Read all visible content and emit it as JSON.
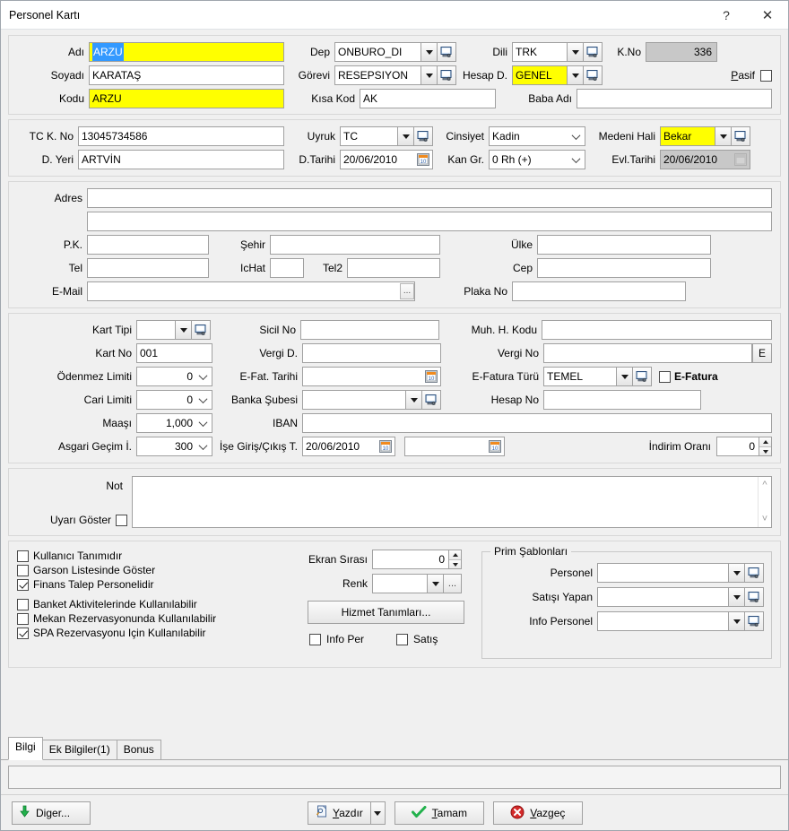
{
  "window": {
    "title": "Personel Kartı",
    "help_label": "?",
    "close_label": "✕"
  },
  "identity": {
    "adi_label": "Adı",
    "adi_value": "ARZU",
    "soyadi_label": "Soyadı",
    "soyadi_value": "KARATAŞ",
    "kodu_label": "Kodu",
    "kodu_value": "ARZU",
    "dep_label": "Dep",
    "dep_value": "ONBURO_DI",
    "gorevi_label": "Görevi",
    "gorevi_value": "RESEPSIYON",
    "kisa_kod_label": "Kısa Kod",
    "kisa_kod_value": "AK",
    "dili_label": "Dili",
    "dili_value": "TRK",
    "hesap_d_label": "Hesap D.",
    "hesap_d_value": "GENEL",
    "baba_adi_label": "Baba Adı",
    "baba_adi_value": "",
    "kno_label": "K.No",
    "kno_value": "336",
    "pasif_label": "Pasif",
    "pasif_checked": false
  },
  "personal": {
    "tc_label": "TC K. No",
    "tc_value": "13045734586",
    "dyeri_label": "D. Yeri",
    "dyeri_value": "ARTVİN",
    "uyruk_label": "Uyruk",
    "uyruk_value": "TC",
    "dtarihi_label": "D.Tarihi",
    "dtarihi_value": "20/06/2010",
    "cinsiyet_label": "Cinsiyet",
    "cinsiyet_value": "Kadin",
    "kangr_label": "Kan Gr.",
    "kangr_value": "0 Rh (+)",
    "medeni_label": "Medeni Hali",
    "medeni_value": "Bekar",
    "evltarihi_label": "Evl.Tarihi",
    "evltarihi_value": "20/06/2010"
  },
  "address": {
    "adres_label": "Adres",
    "adres_line1": "",
    "adres_line2": "",
    "pk_label": "P.K.",
    "pk_value": "",
    "sehir_label": "Şehir",
    "sehir_value": "",
    "ulke_label": "Ülke",
    "ulke_value": "",
    "tel_label": "Tel",
    "tel_value": "",
    "ichat_label": "IcHat",
    "ichat_value": "",
    "tel2_label": "Tel2",
    "tel2_value": "",
    "cep_label": "Cep",
    "cep_value": "",
    "email_label": "E-Mail",
    "email_value": "",
    "email_browse_label": "...",
    "plaka_label": "Plaka No",
    "plaka_value": ""
  },
  "financial": {
    "kart_tipi_label": "Kart Tipi",
    "kart_tipi_value": "",
    "kart_no_label": "Kart No",
    "kart_no_value": "001",
    "odenmez_label": "Ödenmez Limiti",
    "odenmez_value": "0",
    "cari_label": "Cari Limiti",
    "cari_value": "0",
    "maasi_label": "Maaşı",
    "maasi_value": "1,000",
    "asgari_label": "Asgari Geçim İ.",
    "asgari_value": "300",
    "sicil_label": "Sicil No",
    "sicil_value": "",
    "vergi_d_label": "Vergi D.",
    "vergi_d_value": "",
    "efat_tarihi_label": "E-Fat. Tarihi",
    "efat_tarihi_value": "",
    "banka_subesi_label": "Banka Şubesi",
    "banka_subesi_value": "",
    "iban_label": "IBAN",
    "iban_value": "",
    "ise_giris_label": "İşe Giriş/Çıkış T.",
    "ise_giris_value": "20/06/2010",
    "ise_cikis_value": "",
    "muh_h_kodu_label": "Muh. H. Kodu",
    "muh_h_kodu_value": "",
    "vergi_no_label": "Vergi No",
    "vergi_no_value": "",
    "vergi_no_button": "E",
    "efatura_turu_label": "E-Fatura Türü",
    "efatura_turu_value": "TEMEL",
    "efatura_label": "E-Fatura",
    "efatura_checked": false,
    "hesap_no_label": "Hesap No",
    "hesap_no_value": "",
    "indirim_label": "İndirim Oranı",
    "indirim_value": "0"
  },
  "note": {
    "not_label": "Not",
    "not_value": "",
    "uyari_goster_label": "Uyarı Göster",
    "uyari_goster_checked": false
  },
  "options": {
    "checkboxes": [
      {
        "label": "Kullanıcı Tanımıdır",
        "checked": false
      },
      {
        "label": "Garson Listesinde Göster",
        "checked": false
      },
      {
        "label": "Finans Talep Personelidir",
        "checked": true
      },
      {
        "label": "Banket Aktivitelerinde Kullanılabilir",
        "checked": false
      },
      {
        "label": "Mekan Rezervasyonunda Kullanılabilir",
        "checked": false
      },
      {
        "label": "SPA Rezervasyonu Için Kullanılabilir",
        "checked": true
      }
    ],
    "ekran_sirasi_label": "Ekran Sırası",
    "ekran_sirasi_value": "0",
    "renk_label": "Renk",
    "renk_value": "",
    "renk_browse_label": "...",
    "hizmet_button": "Hizmet Tanımları...",
    "info_per_label": "Info Per",
    "info_per_checked": false,
    "satis_label": "Satış",
    "satis_checked": false
  },
  "prim": {
    "group_title": "Prim Şablonları",
    "personel_label": "Personel",
    "personel_value": "",
    "satisi_yapan_label": "Satışı Yapan",
    "satisi_yapan_value": "",
    "info_personel_label": "Info Personel",
    "info_personel_value": ""
  },
  "tabs": [
    {
      "label": "Bilgi",
      "active": true
    },
    {
      "label": "Ek Bilgiler(1)",
      "active": false
    },
    {
      "label": "Bonus",
      "active": false
    }
  ],
  "statusbar": {
    "text": ""
  },
  "footer": {
    "diger_pre": "Di",
    "diger_mn": "g",
    "diger_post": "er...",
    "yazdir_mn": "Y",
    "yazdir_post": "azdır",
    "tamam_mn": "T",
    "tamam_post": "amam",
    "vazgec_pre": "V",
    "vazgec_post": "azgeç"
  },
  "colors": {
    "highlight_yellow": "#ffff00",
    "selection_blue": "#3399ff",
    "disabled_gray": "#c8c8c8",
    "window_bg": "#f0f0f0",
    "ok_green": "#22b14c",
    "cancel_red": "#d42a2a"
  }
}
